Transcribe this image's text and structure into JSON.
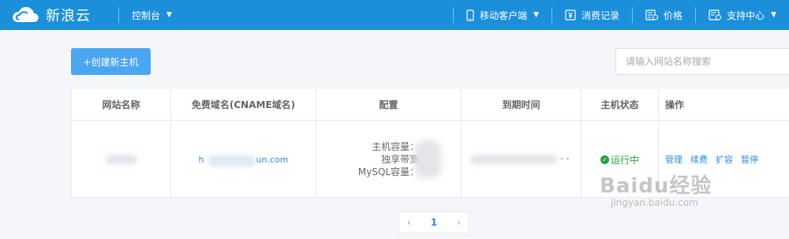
{
  "brand": {
    "name": "新浪云"
  },
  "nav": {
    "console": "控制台",
    "mobile": "移动客户端",
    "billing": "消费记录",
    "price": "价格",
    "support": "支持中心"
  },
  "main": {
    "create_button": "+创建新主机",
    "search_placeholder": "请输入网站名称搜索"
  },
  "table": {
    "headers": [
      "网站名称",
      "免费域名(CNAME域名)",
      "配置",
      "到期时间",
      "主机状态",
      "操作"
    ],
    "rows": [
      {
        "domain_start": "h",
        "domain_end": "un.com",
        "config_lines": [
          "主机容量：",
          "独享带宽",
          "MySQL容量："
        ],
        "expire_tail": "- -",
        "status": "运行中",
        "actions": [
          "管理",
          "续费",
          "扩容",
          "暂停"
        ]
      }
    ]
  },
  "pagination": {
    "prev": "‹",
    "current": "1",
    "next": "›"
  },
  "watermark": {
    "big": "Baidu经验",
    "small": "jingyan.baidu.com"
  },
  "colors": {
    "topbar": "#1c8fdb",
    "primary_button": "#4aa6f0",
    "link": "#2b8be0",
    "status_green": "#22a33a"
  }
}
